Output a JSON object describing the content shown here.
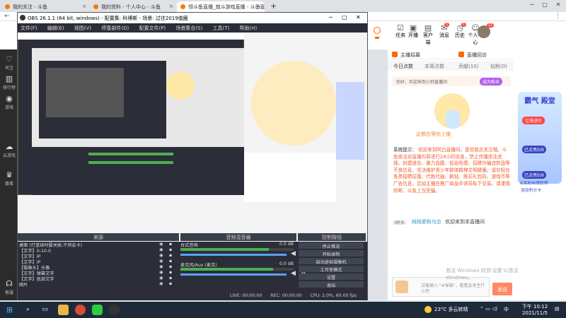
{
  "browser": {
    "tabs": [
      {
        "label": "我的关注 - 斗鱼"
      },
      {
        "label": "我的资料 - 个人中心 - 斗鱼"
      },
      {
        "label": "领斗鱼直播_炮斗游戏直播 - 斗鱼直"
      }
    ],
    "new_tab": "+"
  },
  "douyu": {
    "left_nav": [
      {
        "label": "关注",
        "icon": "heart-icon"
      },
      {
        "label": "排行榜",
        "icon": "ranking-icon"
      },
      {
        "label": "游戏",
        "icon": "gamepad-icon"
      },
      {
        "label": "云游戏",
        "icon": "cloud-game-icon"
      },
      {
        "label": "赛事",
        "icon": "trophy-icon"
      },
      {
        "label": "客服",
        "icon": "headset-icon"
      }
    ],
    "header_icons": [
      {
        "label": "任务",
        "icon": "task-icon"
      },
      {
        "label": "开播",
        "icon": "broadcast-icon"
      },
      {
        "label": "客户端",
        "icon": "client-icon"
      },
      {
        "label": "消息",
        "icon": "message-icon"
      },
      {
        "label": "历史",
        "icon": "history-icon"
      },
      {
        "label": "个人中心",
        "icon": "profile-icon"
      }
    ],
    "badges": {
      "tasks": "1",
      "messages": "5",
      "user": "11"
    },
    "panel_tabs": {
      "anchor": "主播招募",
      "room": "直播回访"
    },
    "rank_tabs": [
      "今日点数",
      "本周点数",
      "贡献(10)",
      "钻粉(0)"
    ],
    "welcome": "你好，欢迎来到小狗直播间",
    "become_fan": "成为粉丝",
    "mascot_caption": "这都在等你上播",
    "system_notice_label": "系统提示：",
    "system_notice": "欢迎来到阿白直播间，喜欢就点关注哦。斗鱼依法对直播内容进行24小时巡查，禁止传播违法违规、封建迷信、暴力血腥、低俗色情、招嫖诈骗违禁品等不良信息，坚决维护青少年群体精神文明健康。请勿轻信各类招聘征婚、代练代抽、刷钻、购买礼包码、游戏币等广告信息，且如主播在推广商品中诱导私下交易，请谨慎判断，以免上当受骗。",
    "welcome_line_user": "纯纯爱粉乌总",
    "welcome_line_text": "欢迎来到本直播间",
    "level_badge": "LV 1",
    "chat_placeholder": "试着输入 \"#弹幕\"，看看会发生什么吧",
    "send_label": "发送",
    "ad_top": "霸气 殿堂",
    "ad_btn_1": "壮镜进阶",
    "ad_label_1": "已点亮0/9",
    "ad_label_2": "已点亮0/9",
    "ad_btn_2": "点亮粉丝牌获得",
    "ad_btn_3": "双倍积分卡",
    "watermark": "激活 Windows 转到'设置'以激活 Windows。"
  },
  "obs": {
    "title": "OBS 26.1.1 (64 bit, windows) - 配置集: 科博斯 - 场景: 过往2019值圈",
    "menu": [
      "文件(F)",
      "编辑(E)",
      "视图(V)",
      "停靠部件(D)",
      "配置文件(P)",
      "场景集合(S)",
      "工具(T)",
      "帮助(H)"
    ],
    "docks": {
      "sources": "来源",
      "mixer": "音频混音器",
      "controls": "控制按钮"
    },
    "sources": [
      "桌面 (打篮球时要关掉,不然会卡)",
      "【文字】0-10-0",
      "【文字】IP",
      "【文字】IP",
      "【摄像头】头像",
      "【文字】弹幕文字",
      "【文字】底部文字",
      "图片"
    ],
    "mixer": [
      {
        "name": "台式音响",
        "db": "0.0 dB",
        "level": 0.78
      },
      {
        "name": "麦克风/Aux (麦克)",
        "db": "0.0 dB",
        "level": 0.82
      }
    ],
    "controls": [
      "停止推流",
      "开始录制",
      "启动虚拟摄像机",
      "工作室模式",
      "设置",
      "退出"
    ],
    "status": {
      "live": "LIVE: 00:00:00",
      "rec": "REC: 00:00:00",
      "cpu": "CPU: 2.0%, 60.00 fps"
    }
  },
  "taskbar": {
    "search_icon": "search-icon",
    "weather": "23°C 多云转晴",
    "lang": "中",
    "time": "下午 10:12",
    "date": "2021/11/5"
  }
}
